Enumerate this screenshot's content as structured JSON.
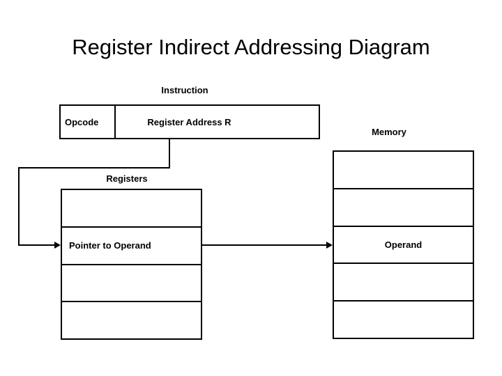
{
  "page": {
    "title": "Register Indirect Addressing Diagram",
    "background_color": "#ffffff",
    "line_color": "#000000",
    "text_color": "#000000"
  },
  "captions": {
    "instruction": "Instruction",
    "registers": "Registers",
    "memory": "Memory"
  },
  "instruction_box": {
    "fields": [
      {
        "label": "Opcode"
      },
      {
        "label": "Register Address R"
      }
    ]
  },
  "registers_table": {
    "rows": [
      {
        "label": ""
      },
      {
        "label": "Pointer to Operand"
      },
      {
        "label": ""
      },
      {
        "label": ""
      }
    ]
  },
  "memory_table": {
    "rows": [
      {
        "label": ""
      },
      {
        "label": ""
      },
      {
        "label": "Operand"
      },
      {
        "label": ""
      },
      {
        "label": ""
      }
    ]
  },
  "connectors": [
    {
      "name": "register-address-to-registers",
      "from": "Register Address R",
      "to": "Pointer to Operand"
    },
    {
      "name": "pointer-to-operand-to-memory",
      "from": "Pointer to Operand",
      "to": "Operand"
    }
  ]
}
